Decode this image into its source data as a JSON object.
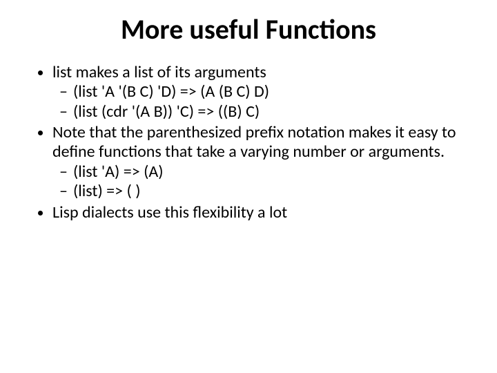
{
  "title": "More useful Functions",
  "bullets": {
    "b1": "list makes a list of its arguments",
    "b1a": "(list 'A '(B C) 'D) => (A (B C) D)",
    "b1b": "(list (cdr '(A B)) 'C) => ((B) C)",
    "b2": "Note that the parenthesized prefix notation makes it easy to define functions that take a varying number or arguments.",
    "b2a": "(list 'A) => (A)",
    "b2b": "(list) => ( )",
    "b3": "Lisp dialects use this flexibility a lot"
  }
}
